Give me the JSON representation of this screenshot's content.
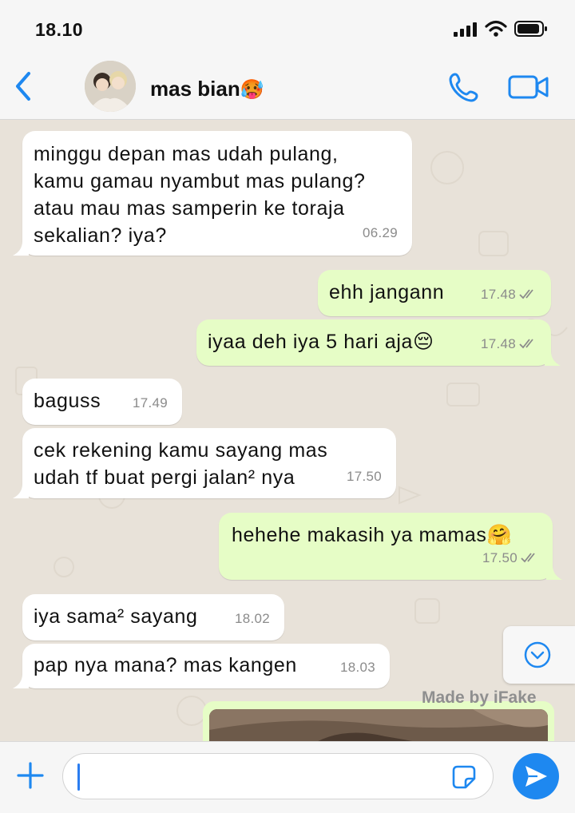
{
  "status_bar": {
    "time": "18.10"
  },
  "header": {
    "contact_name": "mas bian",
    "contact_emoji": "🥵"
  },
  "messages": [
    {
      "dir": "in",
      "text": "minggu depan mas udah pulang,\nkamu gamau nyambut mas pulang?\natau mau mas samperin ke toraja\nsekalian? iya?",
      "time": "06.29"
    },
    {
      "dir": "out",
      "text": "ehh jangann",
      "time": "17.48",
      "status": "read"
    },
    {
      "dir": "out",
      "text": "iyaa deh iya 5 hari aja😔",
      "time": "17.48",
      "status": "read"
    },
    {
      "dir": "in",
      "text": "baguss",
      "time": "17.49"
    },
    {
      "dir": "in",
      "text": "cek rekening kamu sayang mas\nudah tf buat pergi jalan² nya",
      "time": "17.50"
    },
    {
      "dir": "out",
      "text": "hehehe makasih ya mamas🤗",
      "time": "17.50",
      "status": "read"
    },
    {
      "dir": "in",
      "text": "iya sama² sayang",
      "time": "18.02"
    },
    {
      "dir": "in",
      "text": "pap nya mana? mas kangen",
      "time": "18.03"
    }
  ],
  "watermark": "Made by iFake",
  "input": {
    "value": ""
  },
  "colors": {
    "accent": "#1e88f0",
    "incoming": "#ffffff",
    "outgoing": "#e6fdc6",
    "background": "#e8e2d9"
  },
  "icons": [
    "back-chevron-icon",
    "phone-icon",
    "video-camera-icon",
    "signal-icon",
    "wifi-icon",
    "battery-icon",
    "plus-icon",
    "sticker-icon",
    "send-icon",
    "scroll-down-icon",
    "double-check-icon"
  ]
}
